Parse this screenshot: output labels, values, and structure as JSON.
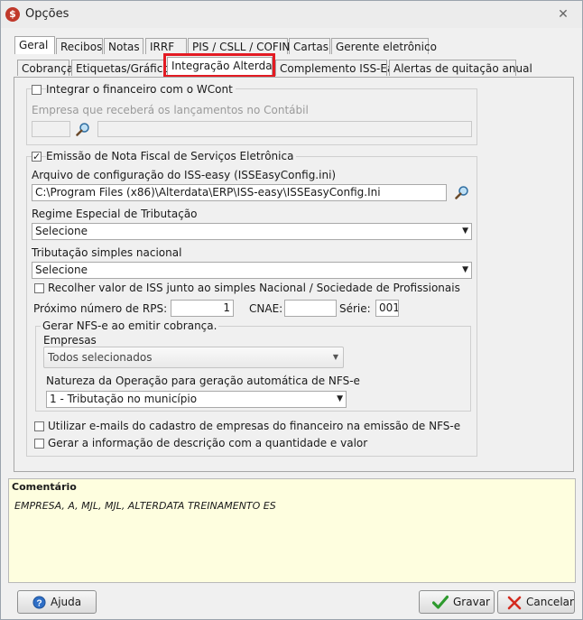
{
  "window": {
    "title": "Opções",
    "app_icon": "$",
    "close_glyph": "✕"
  },
  "tabs_row1": [
    "Geral",
    "Recibos",
    "Notas",
    "IRRF",
    "PIS / CSLL / COFINS",
    "Cartas",
    "Gerente eletrônico"
  ],
  "tabs_row2": [
    "Cobrança",
    "Etiquetas/Gráficos",
    "Integração Alterdata",
    "Complemento ISS-Easy",
    "Alertas de quitação anual"
  ],
  "integracao": {
    "checkbox_label": "Integrar o financeiro com o WCont",
    "checked": false,
    "empresa_label": "Empresa que receberá os lançamentos no Contábil",
    "empresa_code": "",
    "empresa_name": ""
  },
  "nfse": {
    "checkbox_label": "Emissão de Nota Fiscal de Serviços Eletrônica",
    "checked": true,
    "arquivo_label": "Arquivo de configuração do ISS-easy (ISSEasyConfig.ini)",
    "arquivo_value": "C:\\Program Files (x86)\\Alterdata\\ERP\\ISS-easy\\ISSEasyConfig.Ini",
    "regime_label": "Regime Especial de Tributação",
    "regime_value": "Selecione",
    "simples_label": "Tributação simples nacional",
    "simples_value": "Selecione",
    "recolher_label": "Recolher valor de ISS junto ao simples Nacional / Sociedade de Profissionais",
    "rps_label": "Próximo número de RPS:",
    "rps_value": "1",
    "cnae_label": "CNAE:",
    "cnae_value": "",
    "serie_label": "Série:",
    "serie_value": "001"
  },
  "gerar": {
    "group_label": "Gerar NFS-e ao emitir cobrança.",
    "empresas_label": "Empresas",
    "empresas_value": "Todos selecionados",
    "natureza_label": "Natureza da Operação para geração automática de NFS-e",
    "natureza_value": "1 - Tributação no município"
  },
  "options": {
    "emails_label": "Utilizar e-mails do cadastro de empresas do financeiro na emissão de NFS-e",
    "descricao_label": "Gerar a informação de descrição com a quantidade e valor"
  },
  "comment": {
    "title": "Comentário",
    "text": "EMPRESA, A, MJL, MJL, ALTERDATA TREINAMENTO ES"
  },
  "buttons": {
    "help": "Ajuda",
    "save": "Gravar",
    "cancel": "Cancelar"
  },
  "colors": {
    "highlight": "#e31b23",
    "comment_bg": "#fefedf"
  }
}
